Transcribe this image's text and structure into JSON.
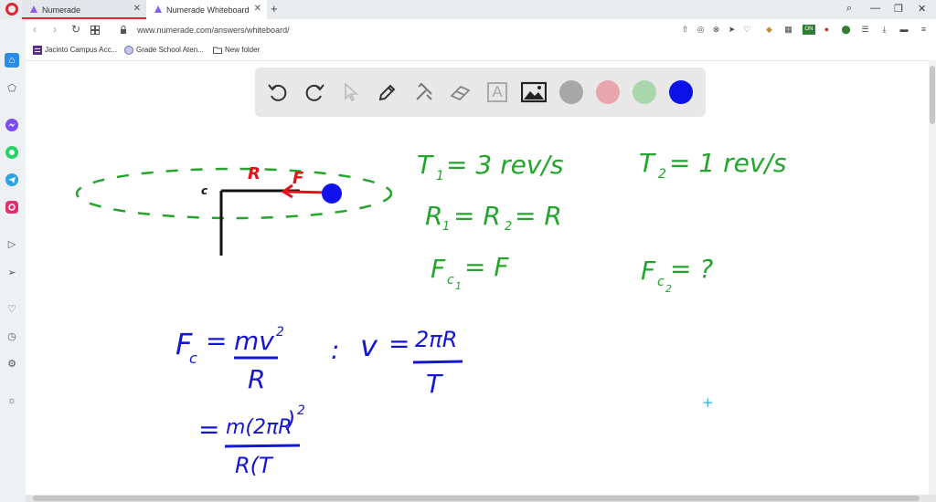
{
  "browser": {
    "tabs": [
      {
        "label": "Numerade",
        "active": false
      },
      {
        "label": "Numerade Whiteboard",
        "active": true
      }
    ],
    "new_tab_label": "+",
    "address": "www.numerade.com/answers/whiteboard/",
    "bookmarks": [
      {
        "label": "Jacinto Campus Acc..."
      },
      {
        "label": "Grade School Aten..."
      },
      {
        "label": "New folder"
      }
    ],
    "window_controls": {
      "search": "⌕",
      "minimize": "—",
      "restore": "❐",
      "close": "✕"
    },
    "extension_badge": "ON",
    "accent_color": "#e0262d"
  },
  "toolbar": {
    "tools": [
      "undo-icon",
      "redo-icon",
      "select-icon",
      "pen-icon",
      "tools-icon",
      "eraser-icon",
      "text-icon",
      "image-icon"
    ],
    "text_tool_glyph": "A",
    "colors": [
      {
        "name": "gray",
        "hex": "#a7a7a7"
      },
      {
        "name": "pink",
        "hex": "#e8a6ad"
      },
      {
        "name": "light-green",
        "hex": "#a9d6ac"
      },
      {
        "name": "blue",
        "hex": "#0c11e6"
      }
    ]
  },
  "whiteboard": {
    "diagram": {
      "center_label": "c",
      "radius_label": "R",
      "force_label": "F"
    },
    "given": {
      "t1_symbol": "T",
      "t1_sub": "1",
      "t1_value": "= 3 rev/s",
      "t2_symbol": "T",
      "t2_sub": "2",
      "t2_value": "= 1 rev/s",
      "r_symbol": "R",
      "r_sub1": "1",
      "r_mid": "= R",
      "r_sub2": "2",
      "r_value": "= R",
      "fc1_symbol": "F",
      "fc1_sub": "c",
      "fc1_subsub": "1",
      "fc1_value": "= F",
      "fc2_symbol": "F",
      "fc2_sub": "c",
      "fc2_subsub": "2",
      "fc2_value": "= ?"
    },
    "formulas": {
      "fc_symbol": "F",
      "fc_sub": "c",
      "eq": "=",
      "fc_numerator": "mv",
      "fc_exponent": "2",
      "fc_denominator": "R",
      "separator": ":",
      "v_symbol": "v",
      "v_eq": "=",
      "v_numerator": "2πR",
      "v_denominator": "T",
      "line3_eq": "=",
      "line3_numerator": "m(2πR",
      "line3_exponent": "2",
      "line3_denominator": "R(T",
      "line3_close": ")"
    },
    "ink_colors": {
      "green": "#23a52c",
      "blue": "#1515d4",
      "red": "#e3121b",
      "black": "#111111",
      "ball": "#1111ee"
    }
  }
}
